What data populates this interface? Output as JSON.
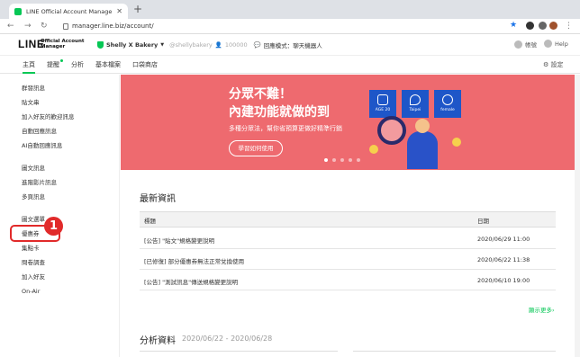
{
  "browser": {
    "tab_title": "LINE Official Account Manager",
    "url": "manager.line.biz/account/"
  },
  "header": {
    "logo": "LINE",
    "logo_sub1": "Official Account",
    "logo_sub2": "Manager",
    "account_name": "Shelly X Bakery",
    "account_id": "@shellybakery",
    "followers": "100000",
    "chat_mode": "回應模式：聊天機器人",
    "account_label": "帳號",
    "help_label": "Help"
  },
  "main_tabs": [
    "主頁",
    "提醒",
    "分析",
    "基本檔案",
    "口袋商店"
  ],
  "settings_label": "設定",
  "sidebar": {
    "items": [
      "群發訊息",
      "貼文串",
      "加入好友的歡迎訊息",
      "自動回應訊息",
      "AI自動回應訊息",
      "圖文訊息",
      "進階影片訊息",
      "多頁訊息",
      "圖文選單",
      "優惠券",
      "集點卡",
      "問卷調查",
      "加入好友",
      "On-Air"
    ]
  },
  "callout": {
    "number": "1"
  },
  "banner": {
    "line1": "分眾不難！",
    "line2": "內建功能就做的到",
    "line3": "多種分眾法，幫你省預算更做好精準行銷",
    "button": "學習如何使用",
    "cards": [
      "AGE 20",
      "Taipei",
      "female"
    ]
  },
  "news": {
    "title": "最新資訊",
    "col_title": "標題",
    "col_date": "日期",
    "rows": [
      {
        "title": "[公告] \"貼文\"規格變更說明",
        "date": "2020/06/29 11:00"
      },
      {
        "title": "[已修復] 部分優惠券無法正常兌換使用",
        "date": "2020/06/22 11:38"
      },
      {
        "title": "[公告] \"測試訊息\"傳送規格變更說明",
        "date": "2020/06/10 19:00"
      }
    ],
    "more": "顯示更多"
  },
  "analysis": {
    "title": "分析資料",
    "range": "2020/06/22 - 2020/06/28"
  },
  "colors": {
    "brand": "#06c755",
    "banner": "#ee6a6f",
    "callout": "#e12a2a",
    "card": "#1e56c8"
  }
}
